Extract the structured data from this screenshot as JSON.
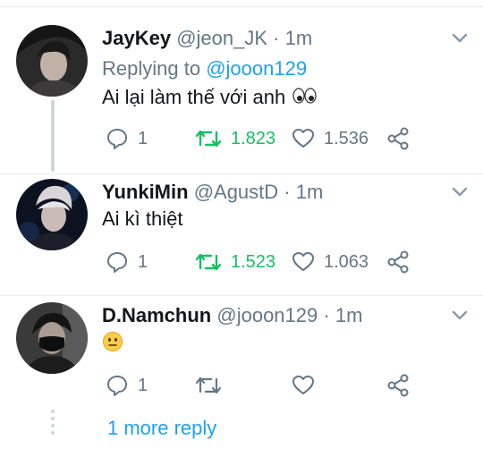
{
  "tweets": [
    {
      "name": "JayKey",
      "handle": "@jeon_JK",
      "sep": "·",
      "time": "1m",
      "replying_prefix": "Replying to",
      "replying_mention": "@jooon129",
      "text": "Ai lại làm thế với anh",
      "text_emoji": "eyes",
      "replies": "1",
      "retweets": "1.823",
      "likes": "1.536",
      "retweeted": true
    },
    {
      "name": "YunkiMin",
      "handle": "@AgustD",
      "sep": "·",
      "time": "1m",
      "text": "Ai kì thiệt",
      "replies": "1",
      "retweets": "1.523",
      "likes": "1.063",
      "retweeted": true
    },
    {
      "name": "D.Namchun",
      "handle": "@jooon129",
      "sep": "·",
      "time": "1m",
      "text_emoji": "neutral-face",
      "replies": "1",
      "retweets": "",
      "likes": "",
      "retweeted": false
    }
  ],
  "more_replies": "1 more reply",
  "colors": {
    "accent": "#1da1f2",
    "retweet_active": "#17bf63",
    "secondary_text": "#657786",
    "border": "#e6ecf0"
  }
}
